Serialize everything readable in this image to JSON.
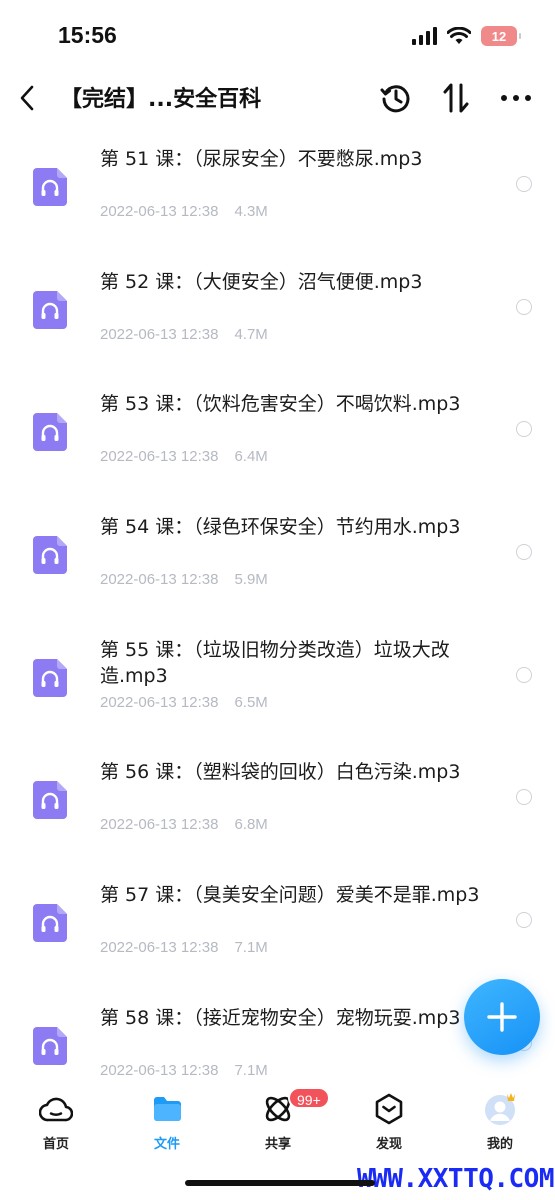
{
  "status_bar": {
    "time": "15:56",
    "battery": "12",
    "icons": [
      "signal-icon",
      "wifi-icon",
      "battery-icon"
    ]
  },
  "nav": {
    "title": "【完结】...安全百科",
    "icons": [
      "back-icon",
      "history-icon",
      "sort-icon",
      "more-icon"
    ]
  },
  "files": [
    {
      "name": "第 51 课：（尿尿安全）不要憋尿.mp3",
      "date": "2022-06-13 12:38",
      "size": "4.3M"
    },
    {
      "name": "第 52 课：（大便安全）沼气便便.mp3",
      "date": "2022-06-13 12:38",
      "size": "4.7M"
    },
    {
      "name": "第 53 课：（饮料危害安全）不喝饮料.mp3",
      "date": "2022-06-13 12:38",
      "size": "6.4M"
    },
    {
      "name": "第 54 课：（绿色环保安全）节约用水.mp3",
      "date": "2022-06-13 12:38",
      "size": "5.9M"
    },
    {
      "name": "第 55 课：（垃圾旧物分类改造）垃圾大改造.mp3",
      "date": "2022-06-13 12:38",
      "size": "6.5M"
    },
    {
      "name": "第 56 课：（塑料袋的回收）白色污染.mp3",
      "date": "2022-06-13 12:38",
      "size": "6.8M"
    },
    {
      "name": "第 57 课：（臭美安全问题）爱美不是罪.mp3",
      "date": "2022-06-13 12:38",
      "size": "7.1M"
    },
    {
      "name": "第 58 课：（接近宠物安全）宠物玩耍.mp3",
      "date": "2022-06-13 12:38",
      "size": "7.1M"
    }
  ],
  "tabs": {
    "home": "首页",
    "files": "文件",
    "share": "共享",
    "discover": "发现",
    "me": "我的",
    "share_badge": "99+"
  },
  "colors": {
    "accent": "#1e9af7",
    "audio_icon": "#8c7bf2",
    "meta_text": "#b5b9c2",
    "badge": "#f2525a"
  },
  "watermark": "WWW.XXTTQ.COM"
}
